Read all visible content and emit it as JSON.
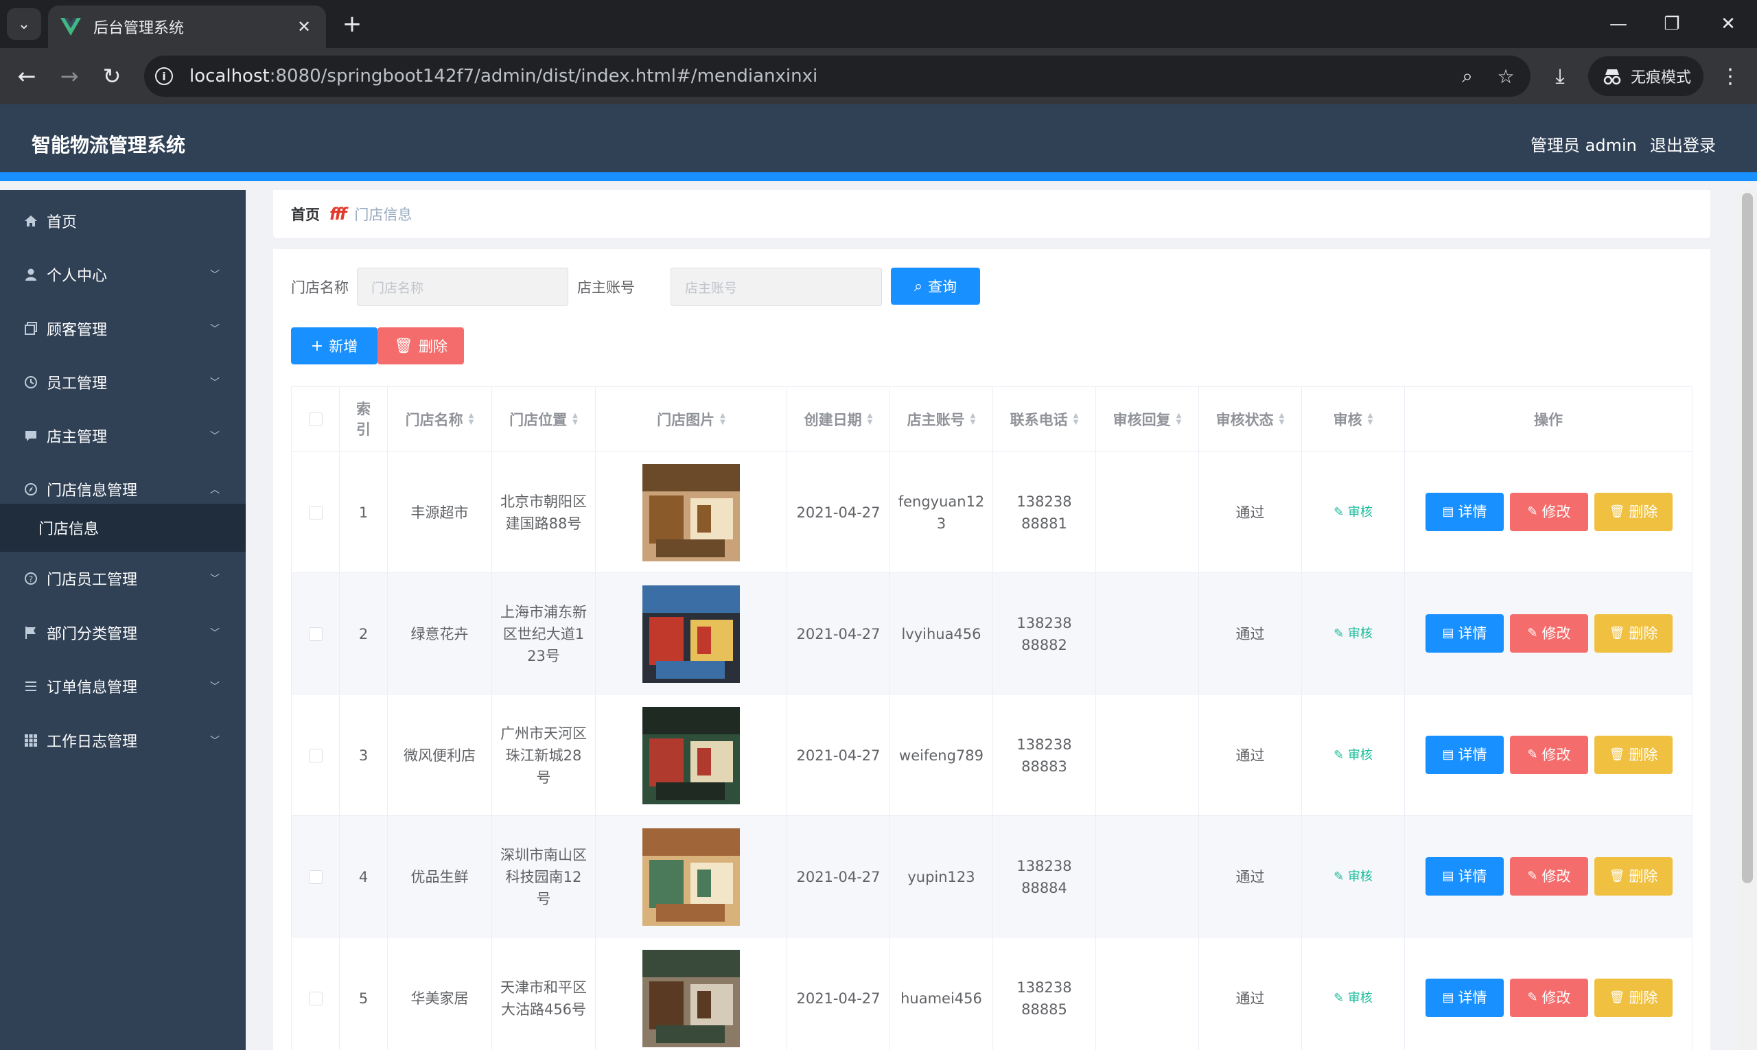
{
  "browser": {
    "tab_title": "后台管理系统",
    "url_host": "localhost",
    "url_rest": ":8080/springboot142f7/admin/dist/index.html#/mendianxinxi",
    "incognito_label": "无痕模式"
  },
  "header": {
    "title": "智能物流管理系统",
    "user": "管理员 admin",
    "logout": "退出登录"
  },
  "sidebar": {
    "items": [
      {
        "label": "首页",
        "icon": "home-icon"
      },
      {
        "label": "个人中心",
        "icon": "user-icon"
      },
      {
        "label": "顾客管理",
        "icon": "copy-icon"
      },
      {
        "label": "员工管理",
        "icon": "clock-icon"
      },
      {
        "label": "店主管理",
        "icon": "chat-icon"
      },
      {
        "label": "门店信息管理",
        "icon": "compass-icon"
      },
      {
        "label": "门店员工管理",
        "icon": "help-icon"
      },
      {
        "label": "部门分类管理",
        "icon": "flag-icon"
      },
      {
        "label": "订单信息管理",
        "icon": "list-icon"
      },
      {
        "label": "工作日志管理",
        "icon": "grid-icon"
      }
    ],
    "submenu_active": "门店信息"
  },
  "breadcrumb": {
    "home": "首页",
    "separator": "fff",
    "current": "门店信息"
  },
  "search": {
    "store_name_label": "门店名称",
    "store_name_placeholder": "门店名称",
    "owner_label": "店主账号",
    "owner_placeholder": "店主账号",
    "query_button": "查询"
  },
  "actions": {
    "add": "新增",
    "delete": "删除"
  },
  "table": {
    "columns": [
      "索引",
      "门店名称",
      "门店位置",
      "门店图片",
      "创建日期",
      "店主账号",
      "联系电话",
      "审核回复",
      "审核状态",
      "审核",
      "操作"
    ],
    "audit_link": "审核",
    "detail_btn": "详情",
    "edit_btn": "修改",
    "delete_btn": "删除",
    "rows": [
      {
        "index": "1",
        "name": "丰源超市",
        "location": "北京市朝阳区建国路88号",
        "date": "2021-04-27",
        "owner": "fengyuan123",
        "phone": "13823888881",
        "reply": "",
        "status": "通过"
      },
      {
        "index": "2",
        "name": "绿意花卉",
        "location": "上海市浦东新区世纪大道123号",
        "date": "2021-04-27",
        "owner": "lvyihua456",
        "phone": "13823888882",
        "reply": "",
        "status": "通过"
      },
      {
        "index": "3",
        "name": "微风便利店",
        "location": "广州市天河区珠江新城28号",
        "date": "2021-04-27",
        "owner": "weifeng789",
        "phone": "13823888883",
        "reply": "",
        "status": "通过"
      },
      {
        "index": "4",
        "name": "优品生鲜",
        "location": "深圳市南山区科技园南12号",
        "date": "2021-04-27",
        "owner": "yupin123",
        "phone": "13823888884",
        "reply": "",
        "status": "通过"
      },
      {
        "index": "5",
        "name": "华美家居",
        "location": "天津市和平区大沽路456号",
        "date": "2021-04-27",
        "owner": "huamei456",
        "phone": "13823888885",
        "reply": "",
        "status": "通过"
      }
    ]
  },
  "colors": {
    "sidebar_bg": "#304156",
    "accent": "#1890ff",
    "danger": "#f56c6c",
    "warning": "#f0c040",
    "audit": "#1bbc9b"
  }
}
